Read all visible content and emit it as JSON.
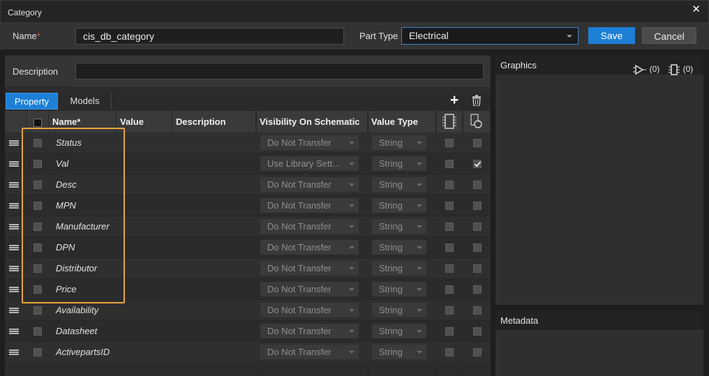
{
  "window": {
    "title": "Category"
  },
  "header": {
    "name_label": "Name",
    "required_marker": "*",
    "name_value": "cis_db_category",
    "part_type_label": "Part Type",
    "part_type_value": "Electrical",
    "save_label": "Save",
    "cancel_label": "Cancel"
  },
  "description": {
    "label": "Description",
    "value": ""
  },
  "tabs": [
    {
      "label": "Property",
      "active": true
    },
    {
      "label": "Models",
      "active": false
    }
  ],
  "grid": {
    "columns": [
      "Name*",
      "Value",
      "Description",
      "Visibility On Schematic",
      "Value Type"
    ],
    "rows": [
      {
        "name": "Status",
        "visibility": "Do Not Transfer",
        "value_type": "String",
        "checked_a": false,
        "checked_b": false
      },
      {
        "name": "Val",
        "visibility": "Use Library Sett...",
        "value_type": "String",
        "checked_a": false,
        "checked_b": true
      },
      {
        "name": "Desc",
        "visibility": "Do Not Transfer",
        "value_type": "String",
        "checked_a": false,
        "checked_b": false
      },
      {
        "name": "MPN",
        "visibility": "Do Not Transfer",
        "value_type": "String",
        "checked_a": false,
        "checked_b": false
      },
      {
        "name": "Manufacturer",
        "visibility": "Do Not Transfer",
        "value_type": "String",
        "checked_a": false,
        "checked_b": false
      },
      {
        "name": "DPN",
        "visibility": "Do Not Transfer",
        "value_type": "String",
        "checked_a": false,
        "checked_b": false
      },
      {
        "name": "Distributor",
        "visibility": "Do Not Transfer",
        "value_type": "String",
        "checked_a": false,
        "checked_b": false
      },
      {
        "name": "Price",
        "visibility": "Do Not Transfer",
        "value_type": "String",
        "checked_a": false,
        "checked_b": false
      },
      {
        "name": "Availability",
        "visibility": "Do Not Transfer",
        "value_type": "String",
        "checked_a": false,
        "checked_b": false
      },
      {
        "name": "Datasheet",
        "visibility": "Do Not Transfer",
        "value_type": "String",
        "checked_a": false,
        "checked_b": false
      },
      {
        "name": "ActivepartsID",
        "visibility": "Do Not Transfer",
        "value_type": "String",
        "checked_a": false,
        "checked_b": false
      }
    ]
  },
  "graphics": {
    "title": "Graphics",
    "symbol_count": "(0)",
    "footprint_count": "(0)"
  },
  "metadata": {
    "title": "Metadata"
  },
  "colors": {
    "accent": "#1d7fd6",
    "highlight": "#e8a53a",
    "required": "#d9534f"
  },
  "icons": [
    "close-icon",
    "plus-icon",
    "trash-icon",
    "symbol-icon",
    "footprint-icon",
    "chevron-down-icon",
    "drag-handle-icon"
  ]
}
